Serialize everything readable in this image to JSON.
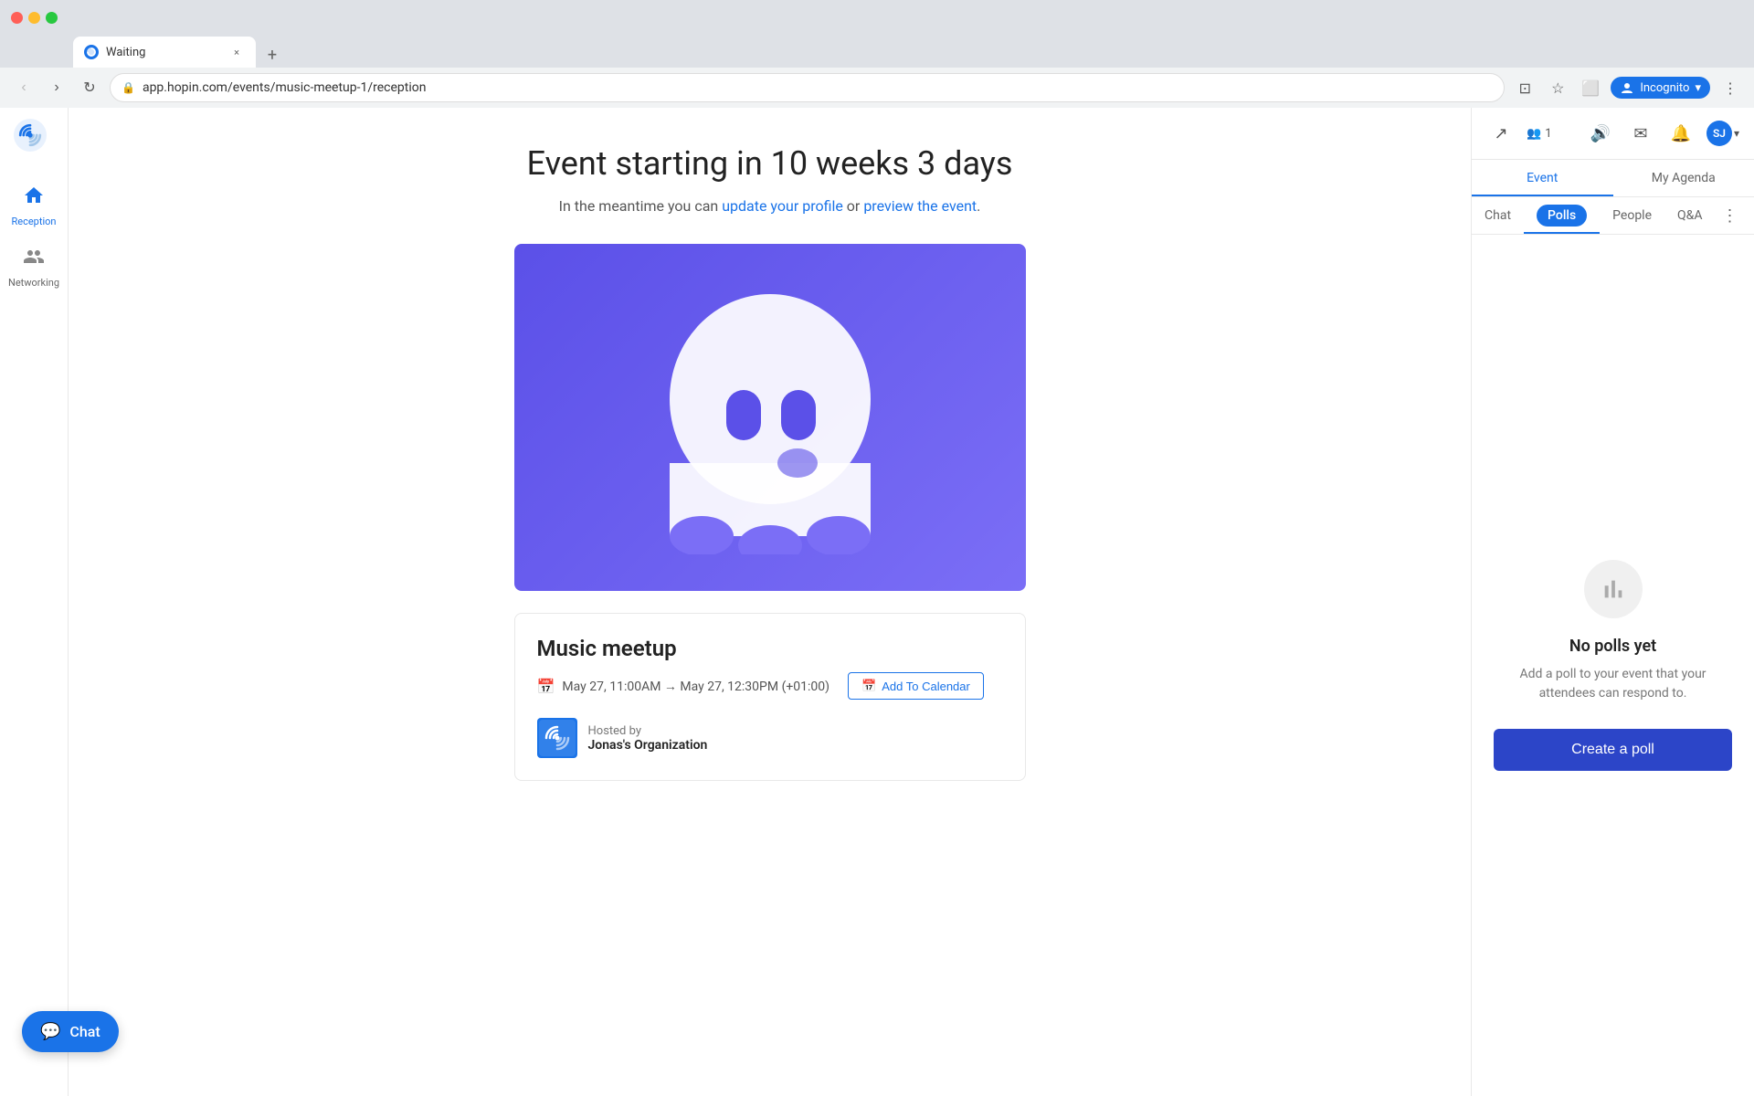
{
  "browser": {
    "tab": {
      "title": "Waiting",
      "url": "app.hopin.com/events/music-meetup-1/reception"
    },
    "tabs": [
      {
        "title": "Waiting",
        "active": true
      }
    ],
    "nav": {
      "back": "‹",
      "forward": "›",
      "reload": "↻"
    },
    "profile": {
      "label": "Incognito"
    }
  },
  "sidebar": {
    "items": [
      {
        "id": "reception",
        "label": "Reception",
        "active": true
      },
      {
        "id": "networking",
        "label": "Networking",
        "active": false
      }
    ]
  },
  "main": {
    "countdown_title": "Event starting in 10 weeks 3 days",
    "subtitle_prefix": "In the meantime you can ",
    "update_profile_link": "update your profile",
    "or_text": " or ",
    "preview_event_link": "preview the event",
    "subtitle_suffix": ".",
    "event_name": "Music meetup",
    "event_date": "May 27, 11:00AM → May 27, 12:30PM (+01:00)",
    "add_to_calendar_label": "Add To Calendar",
    "hosted_by_label": "Hosted by",
    "host_name": "Jonas's Organization"
  },
  "right_panel": {
    "attendees_count": "1",
    "tabs": {
      "event_label": "Event",
      "my_agenda_label": "My Agenda"
    },
    "sub_tabs": {
      "chat": "Chat",
      "polls": "Polls",
      "people": "People",
      "qa": "Q&A"
    },
    "active_tab": "Event",
    "active_sub_tab": "Polls",
    "no_polls_title": "No polls yet",
    "no_polls_desc": "Add a poll to your event that your attendees can respond to.",
    "create_poll_label": "Create a poll"
  },
  "chat_fab": {
    "label": "Chat"
  },
  "icons": {
    "chart_bars": "📊",
    "home": "🏠",
    "handshake": "🤝",
    "calendar_small": "📅",
    "calendar_add": "📅",
    "volume": "🔊",
    "mail": "✉️",
    "bell": "🔔",
    "share": "↗",
    "people": "👥",
    "more_vert": "⋮",
    "chat_bubble": "💬",
    "chevron_down": "▾",
    "lock": "🔒"
  }
}
